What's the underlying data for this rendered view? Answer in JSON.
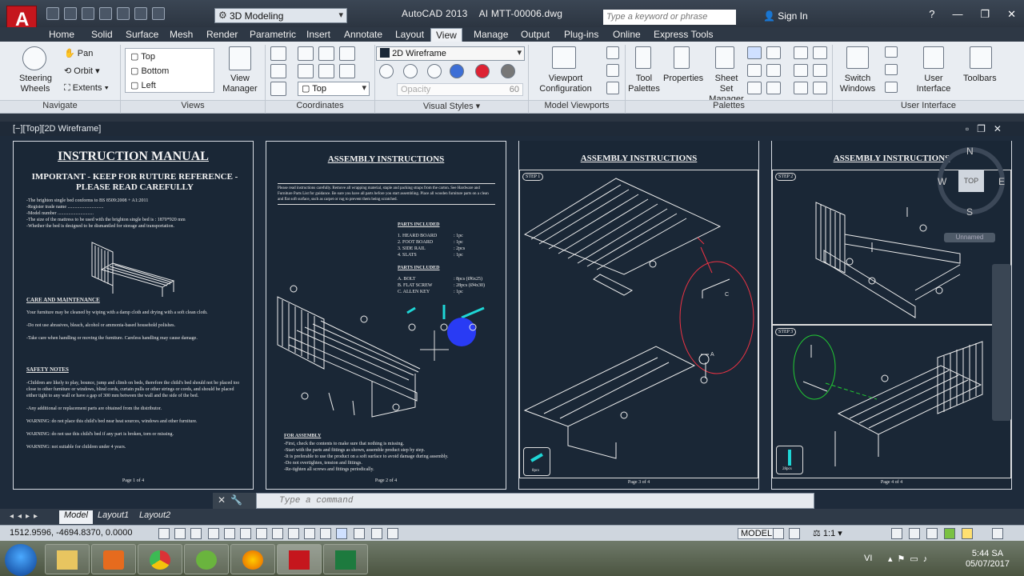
{
  "titlebar": {
    "workspace": "3D Modeling",
    "app_title": "AutoCAD 2013",
    "file_name": "AI MTT-00006.dwg",
    "search_placeholder": "Type a keyword or phrase",
    "sign_in": "Sign In",
    "help": "?",
    "min": "—",
    "max": "❐",
    "close": "✕"
  },
  "ribbon_tabs": [
    "Home",
    "Solid",
    "Surface",
    "Mesh",
    "Render",
    "Parametric",
    "Insert",
    "Annotate",
    "Layout",
    "View",
    "Manage",
    "Output",
    "Plug-ins",
    "Online",
    "Express Tools"
  ],
  "active_tab": "View",
  "ribbon": {
    "navigate": {
      "title": "Navigate",
      "steering": "Steering Wheels",
      "pan": "Pan",
      "orbit": "Orbit",
      "extents": "Extents"
    },
    "views": {
      "title": "Views",
      "top": "Top",
      "bottom": "Bottom",
      "left": "Left",
      "view_manager": "View Manager"
    },
    "coordinates": {
      "title": "Coordinates",
      "ucs_view": "Top"
    },
    "visual_styles": {
      "title": "Visual Styles",
      "style": "2D Wireframe",
      "opacity_label": "Opacity",
      "opacity_value": "60"
    },
    "model_viewports": {
      "title": "Model Viewports",
      "viewport_configuration": "Viewport Configuration"
    },
    "palettes": {
      "title": "Palettes",
      "tool_palettes": "Tool Palettes",
      "properties": "Properties",
      "sheet_set": "Sheet Set Manager"
    },
    "user_interface": {
      "title": "User Interface",
      "switch_windows": "Switch Windows",
      "user_interface": "User Interface",
      "toolbars": "Toolbars"
    }
  },
  "viewport_label": "[−][Top][2D Wireframe]",
  "sheet1": {
    "title": "INSTRUCTION MANUAL",
    "subtitle": "IMPORTANT - KEEP FOR RUTURE REFERENCE - PLEASE READ CAREFULLY",
    "lines": [
      "-The brighton single bed conforms to BS 8509:2008 + A1:2011",
      "-Register trade name ..............................",
      "-Model number ..............................",
      "-The size of the mattress to be used with the brighton single bed is : 1870*920 mm",
      "-Whether the bed is designed to be dismantled for storage and transportation."
    ],
    "care_title": "CARE AND MAINTENANCE",
    "care": [
      "Your furniture may be cleaned by wiping with a damp cloth and drying with a soft clean cloth.",
      "-Do not use abrasives, bleach, alcohol or ammonia-based household polishes.",
      "-Take care when handling or moving the furniture. Careless handling may cause damage."
    ],
    "safety_title": "SAFETY NOTES",
    "safety": [
      "-Children are likely to play, bounce, jump and climb on beds, therefore the child's bed should not be placed too close to other furniture or windows, blind cords, curtain pulls or other strings or cords, and should be placed either tight to any wall or have a gap of 300 mm between the wall and the side of the bed.",
      "-Any additional or replacement parts are obtained from the distributor.",
      "WARNING: do not place this child's bed near heat sources, windows and other furniture.",
      "WARNING: do not use this child's bed if any part is broken, torn or missing.",
      "WARNING: not suitable for children under 4 years."
    ],
    "page": "Page 1 of 4"
  },
  "sheet2": {
    "title": "ASSEMBLY INSTRUCTIONS",
    "intro": "Please read instructions carefully. Remove all wrapping material, staple and packing straps from the carton. See Hardware and Furniture Parts List for guidance. Be sure you have all parts before you start assembling. Place all wooden furniture parts on a clean and flat soft surface, such as carpet or rug to prevent them being scratched.",
    "parts_title": "PARTS INCLUDED",
    "parts": [
      [
        "1. HEARD BOARD",
        ": 1pc"
      ],
      [
        "2. FOOT BOARD",
        ": 1pc"
      ],
      [
        "3. SIDE RAIL",
        ": 2pcs"
      ],
      [
        "4. SLATS",
        ": 1pc"
      ]
    ],
    "hw_title": "PARTS INCLUDED",
    "hardware": [
      [
        "A. BOLT",
        ": 8pcs (Ø6x25)"
      ],
      [
        "B. FLAT SCREW",
        ": 28pcs (Ø4x30)"
      ],
      [
        "C. ALLEN KEY",
        ": 1pc"
      ]
    ],
    "for_title": "FOR ASSEMBLY",
    "for_lines": [
      "-First, check the contents to make sure that nothing is missing.",
      "-Start with the parts and fittings as shown, assemble product step by step.",
      "-It is preferable to use the product on a soft surface to avoid damage during assembly.",
      "-Do not overtighten, tension and fittings.",
      "-Re-tighten all screws and fittings periodically."
    ],
    "page": "Page 2 of 4"
  },
  "sheet3": {
    "title": "ASSEMBLY INSTRUCTIONS",
    "step": "STEP 1",
    "count": "8pcs",
    "page": "Page 3 of 4",
    "label_a": "A",
    "label_c": "C"
  },
  "sheet4": {
    "title": "ASSEMBLY INSTRUCTIONS",
    "step1": "STEP 2",
    "step2": "STEP 3",
    "count": "28pcs",
    "page": "Page 4 of 4"
  },
  "viewcube": {
    "n": "N",
    "s": "S",
    "e": "E",
    "w": "W",
    "top": "TOP",
    "ucs": "Unnamed"
  },
  "command_placeholder": "Type a command",
  "layout_tabs": [
    "Model",
    "Layout1",
    "Layout2"
  ],
  "status": {
    "coords": "1512.9596, -4694.8370, 0.0000",
    "model": "MODEL",
    "scale": "1:1"
  },
  "taskbar": {
    "lang": "VI",
    "time": "5:44 SA",
    "date": "05/07/2017"
  },
  "colors": {
    "accent": "#c5161d",
    "canvas": "#1e2b3b",
    "selection": "#2a3cff",
    "cyan": "#1ed6d6"
  }
}
